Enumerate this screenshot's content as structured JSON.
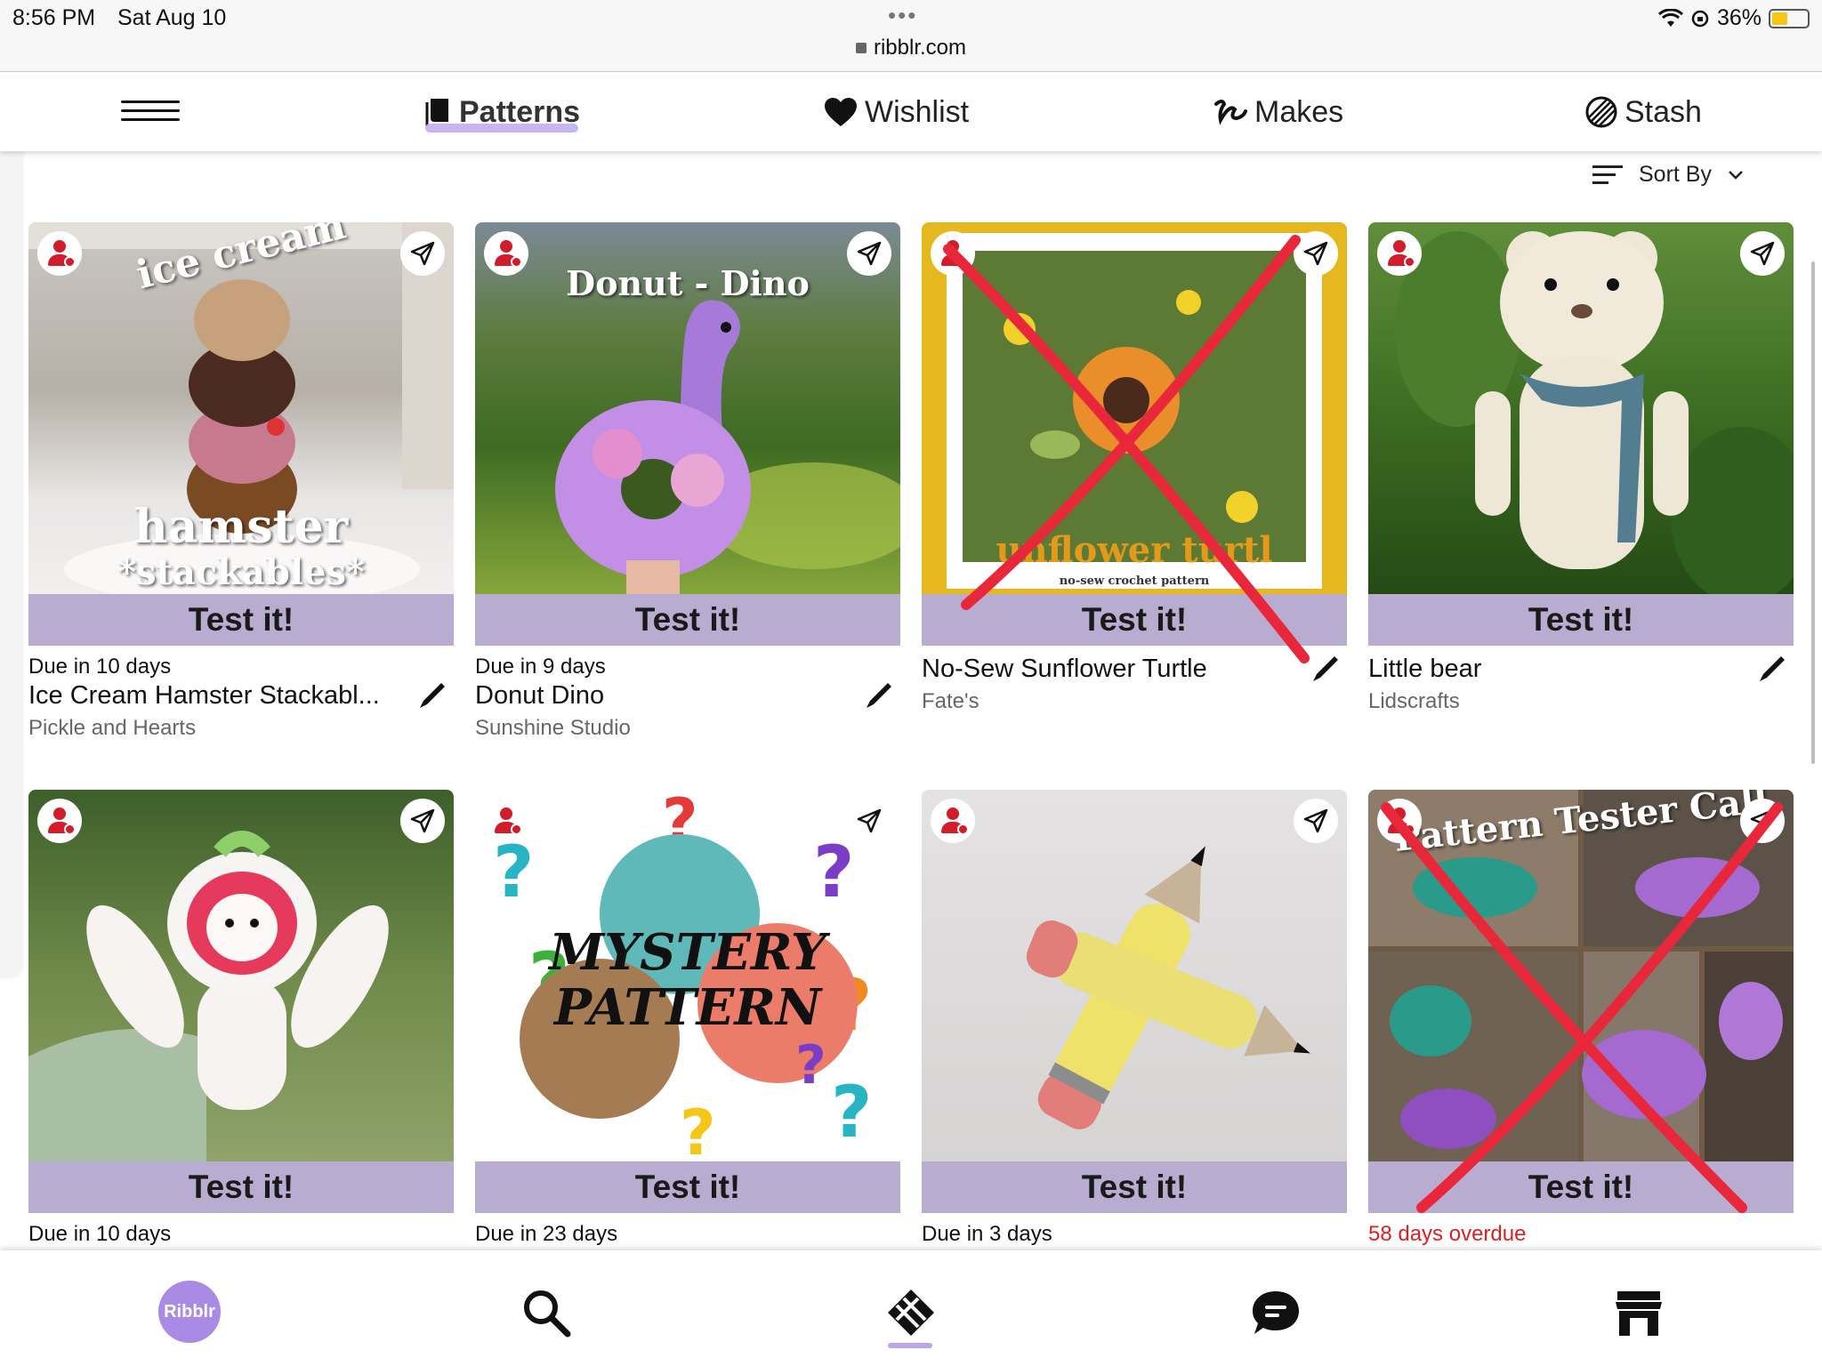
{
  "status": {
    "time": "8:56 PM",
    "date": "Sat Aug 10",
    "url": "ribblr.com",
    "battery": "36%"
  },
  "nav": {
    "items": [
      "Patterns",
      "Wishlist",
      "Makes",
      "Stash"
    ],
    "active": "Patterns"
  },
  "sort": {
    "label": "Sort By"
  },
  "cards": [
    {
      "image_text": [
        "ice cream",
        "hamster",
        "*stackables*"
      ],
      "cta": "Test it!",
      "due": "Due in 10 days",
      "name": "Ice Cream Hamster Stackabl...",
      "designer": "Pickle and Hearts",
      "crossed_out": false
    },
    {
      "image_text": [
        "Donut - Dino"
      ],
      "cta": "Test it!",
      "due": "Due in 9 days",
      "name": "Donut Dino",
      "designer": "Sunshine Studio",
      "crossed_out": false
    },
    {
      "image_text": [
        "unflower turtl",
        "no-sew crochet pattern"
      ],
      "cta": "Test it!",
      "due": "",
      "name": "No-Sew Sunflower Turtle",
      "designer": "Fate's",
      "crossed_out": true
    },
    {
      "image_text": [],
      "cta": "Test it!",
      "due": "",
      "name": "Little bear",
      "designer": "Lidscrafts",
      "crossed_out": false
    },
    {
      "image_text": [],
      "cta": "Test it!",
      "due": "Due in 10 days",
      "name": "",
      "designer": "",
      "crossed_out": false
    },
    {
      "image_text": [
        "MYSTERY",
        "PATTERN"
      ],
      "cta": "Test it!",
      "due": "Due in 23 days",
      "name": "",
      "designer": "",
      "crossed_out": false
    },
    {
      "image_text": [],
      "cta": "Test it!",
      "due": "Due in 3 days",
      "name": "",
      "designer": "",
      "crossed_out": false
    },
    {
      "image_text": [
        "Pattern Tester Call"
      ],
      "cta": "Test it!",
      "due": "58 days overdue",
      "name": "",
      "designer": "",
      "crossed_out": true,
      "overdue": true
    }
  ],
  "bottom": {
    "logo": "Ribblr",
    "icons": [
      "ribblr-logo",
      "search-icon",
      "patterns-icon",
      "chat-icon",
      "store-icon"
    ],
    "active": "patterns-icon"
  },
  "colors": {
    "accent": "#b9a7ea",
    "testbar": "#b8acd0",
    "cross": "#e8283a",
    "overdue": "#e02020"
  }
}
